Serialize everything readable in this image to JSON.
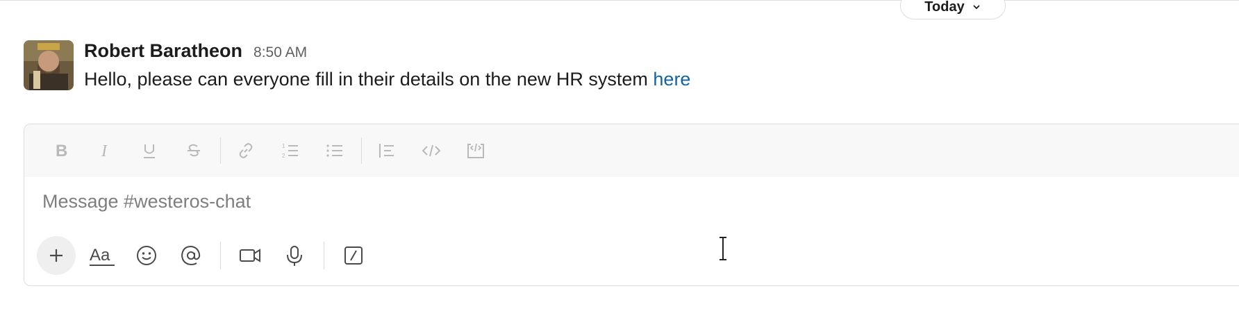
{
  "date_divider": {
    "label": "Today"
  },
  "message": {
    "sender": "Robert Baratheon",
    "time": "8:50 AM",
    "text": "Hello, please can everyone fill in their details on the new HR system ",
    "link_text": "here"
  },
  "composer": {
    "placeholder": "Message #westeros-chat",
    "format_tools": [
      "bold-icon",
      "italic-icon",
      "underline-icon",
      "strikethrough-icon",
      "link-icon",
      "ordered-list-icon",
      "bulleted-list-icon",
      "blockquote-icon",
      "code-icon",
      "code-block-icon"
    ],
    "actions": [
      "plus-icon",
      "text-format-icon",
      "emoji-icon",
      "mention-icon",
      "video-icon",
      "microphone-icon",
      "shortcuts-icon"
    ],
    "text_format_label": "Aa"
  },
  "colors": {
    "link": "#1264a3",
    "muted_icon": "#b9b9b9",
    "icon": "#5e5e5e"
  }
}
